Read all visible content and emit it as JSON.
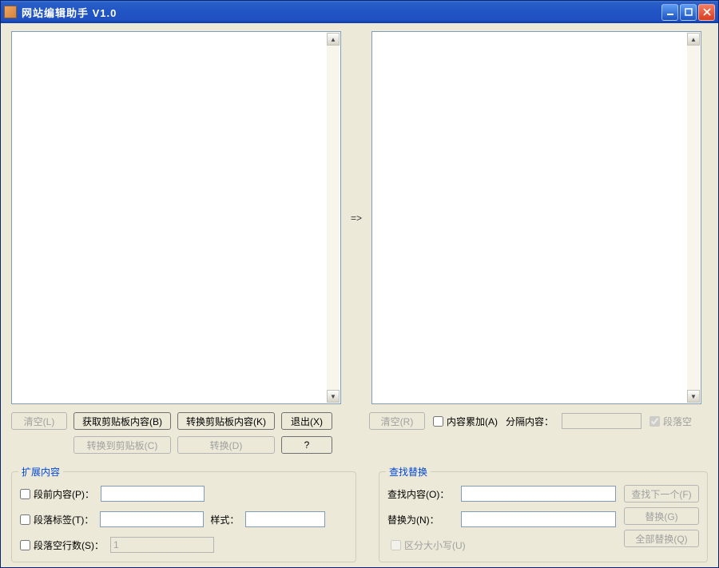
{
  "window": {
    "title": "网站编辑助手  V1.0"
  },
  "arrow": "=>",
  "left_buttons": {
    "clear": "清空(L)",
    "get_clipboard": "获取剪贴板内容(B)",
    "convert_clipboard_content": "转换剪贴板内容(K)",
    "exit": "退出(X)",
    "convert_to_clipboard": "转换到剪贴板(C)",
    "convert": "转换(D)",
    "help": "?"
  },
  "right_controls": {
    "clear": "清空(R)",
    "accumulate": "内容累加(A)",
    "separator_label": "分隔内容：",
    "separator_value": "",
    "paragraph_blank": "段落空"
  },
  "extend_group": {
    "title": "扩展内容",
    "prefix_label": "段前内容(P)：",
    "prefix_value": "",
    "tag_label": "段落标签(T)：",
    "tag_value": "",
    "style_label": "样式：",
    "style_value": "",
    "blank_lines_label": "段落空行数(S)：",
    "blank_lines_value": "1"
  },
  "find_group": {
    "title": "查找替换",
    "find_label": "查找内容(O)：",
    "find_value": "",
    "replace_label": "替换为(N)：",
    "replace_value": "",
    "case_label": "区分大小写(U)",
    "find_next_btn": "查找下一个(F)",
    "replace_btn": "替换(G)",
    "replace_all_btn": "全部替换(Q)"
  }
}
